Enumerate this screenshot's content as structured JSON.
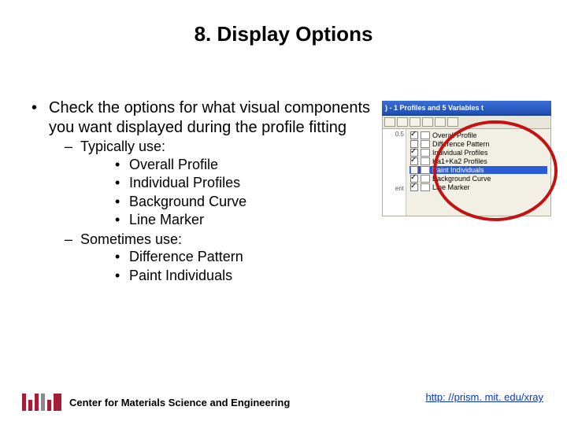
{
  "title": "8. Display Options",
  "bullet_main": "Check the options for what visual components you want displayed during the profile fitting",
  "sub1_label": "Typically use:",
  "sub1_items": [
    "Overall Profile",
    "Individual Profiles",
    "Background Curve",
    "Line Marker"
  ],
  "sub2_label": "Sometimes use:",
  "sub2_items": [
    "Difference Pattern",
    "Paint Individuals"
  ],
  "figure": {
    "titlebar": ") - 1 Profiles and 5 Variables t",
    "axis": [
      "0.5"
    ],
    "sidecell": "ent",
    "rows": [
      {
        "checked": true,
        "label": "Overall Profile",
        "selected": false
      },
      {
        "checked": false,
        "label": "Difference Pattern",
        "selected": false
      },
      {
        "checked": true,
        "label": "Individual Profiles",
        "selected": false
      },
      {
        "checked": true,
        "label": "Ka1+Ka2 Profiles",
        "selected": false
      },
      {
        "checked": false,
        "label": "Paint Individuals",
        "selected": true
      },
      {
        "checked": true,
        "label": "Background Curve",
        "selected": false
      },
      {
        "checked": true,
        "label": "Line Marker",
        "selected": false
      }
    ]
  },
  "footer_text": "Center for Materials Science and Engineering",
  "url": "http: //prism. mit. edu/xray"
}
